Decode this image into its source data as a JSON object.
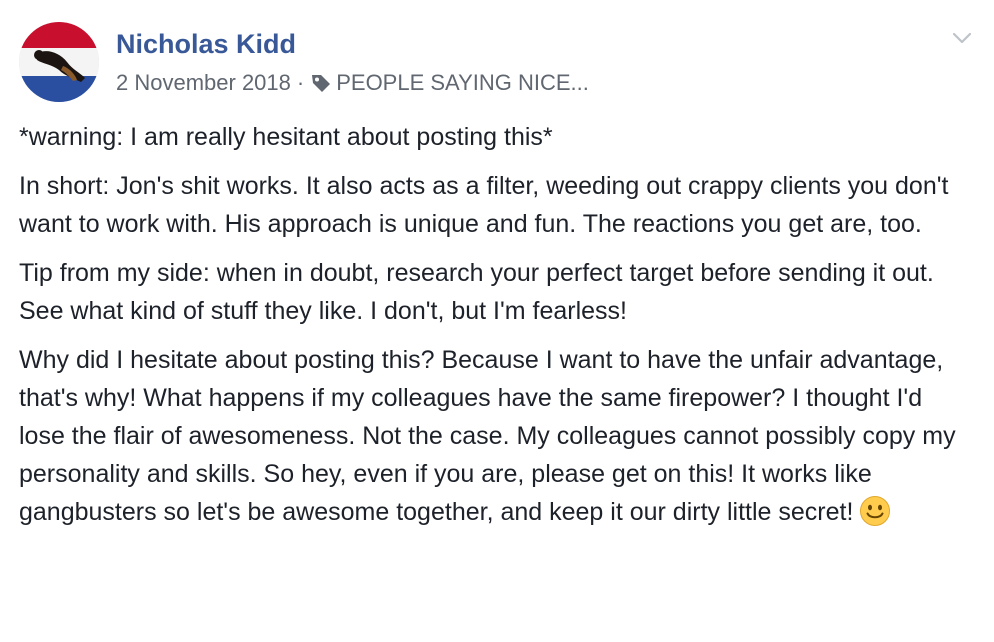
{
  "post": {
    "author": "Nicholas Kidd",
    "date": "2 November 2018",
    "separator": "·",
    "group": "PEOPLE SAYING NICE...",
    "paragraphs": [
      "*warning: I am really hesitant about posting this*",
      "In short: Jon's shit works. It also acts as a filter, weeding out crappy clients you don't want to work with. His approach is unique and fun. The reactions you get are, too.",
      "Tip from my side: when in doubt, research your perfect target before sending it out. See what kind of stuff they like. I don't, but I'm fearless!",
      "Why did I hesitate about posting this? Because I want to have the unfair advantage, that's why! What happens if my colleagues have the same firepower? I thought I'd lose the flair of awesomeness. Not the case. My colleagues cannot possibly copy my personality and skills. So hey, even if you are, please get on this! It works like gangbusters so let's be awesome together, and keep it our dirty little secret!"
    ],
    "icons": {
      "avatar": "profile-photo",
      "tag": "tag-icon",
      "menu": "chevron-down-icon",
      "emoji": "smiley-emoji-icon"
    }
  },
  "colors": {
    "author_link": "#385898",
    "meta_text": "#616770",
    "body_text": "#1d2129",
    "chevron": "#bec3c9",
    "emoji_face": "#ffcc4d"
  }
}
